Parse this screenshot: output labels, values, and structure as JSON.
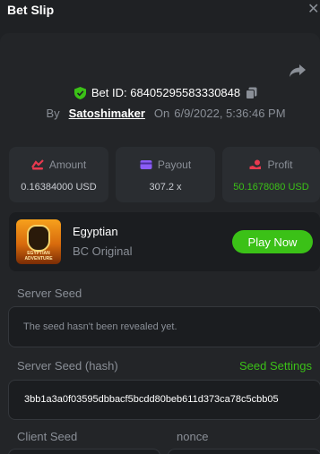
{
  "header": {
    "title": "Bet Slip",
    "close": "✕"
  },
  "bet": {
    "id_label": "Bet ID: 68405295583330848",
    "by_label": "By",
    "user": "Satoshimaker",
    "on_label": "On",
    "date": "6/9/2022, 5:36:46 PM"
  },
  "stats": {
    "amount": {
      "label": "Amount",
      "value": "0.16384000 USD"
    },
    "payout": {
      "label": "Payout",
      "value": "307.2 x"
    },
    "profit": {
      "label": "Profit",
      "value": "50.1678080 USD"
    }
  },
  "game": {
    "name": "Egyptian",
    "subtitle": "BC Original",
    "thumb_text": "EGYPTIAN ADVENTURE",
    "play_label": "Play Now"
  },
  "seeds": {
    "server_label": "Server Seed",
    "server_value": "The seed hasn't been revealed yet.",
    "hash_label": "Server Seed (hash)",
    "settings_label": "Seed Settings",
    "hash_value": "3bb1a3a0f03595dbbacf5bcdd80beb611d373ca78c5cbb05",
    "client_label": "Client Seed",
    "nonce_label": "nonce"
  },
  "colors": {
    "accent": "#3bc117",
    "background": "#1f2124",
    "panel": "#232528"
  }
}
